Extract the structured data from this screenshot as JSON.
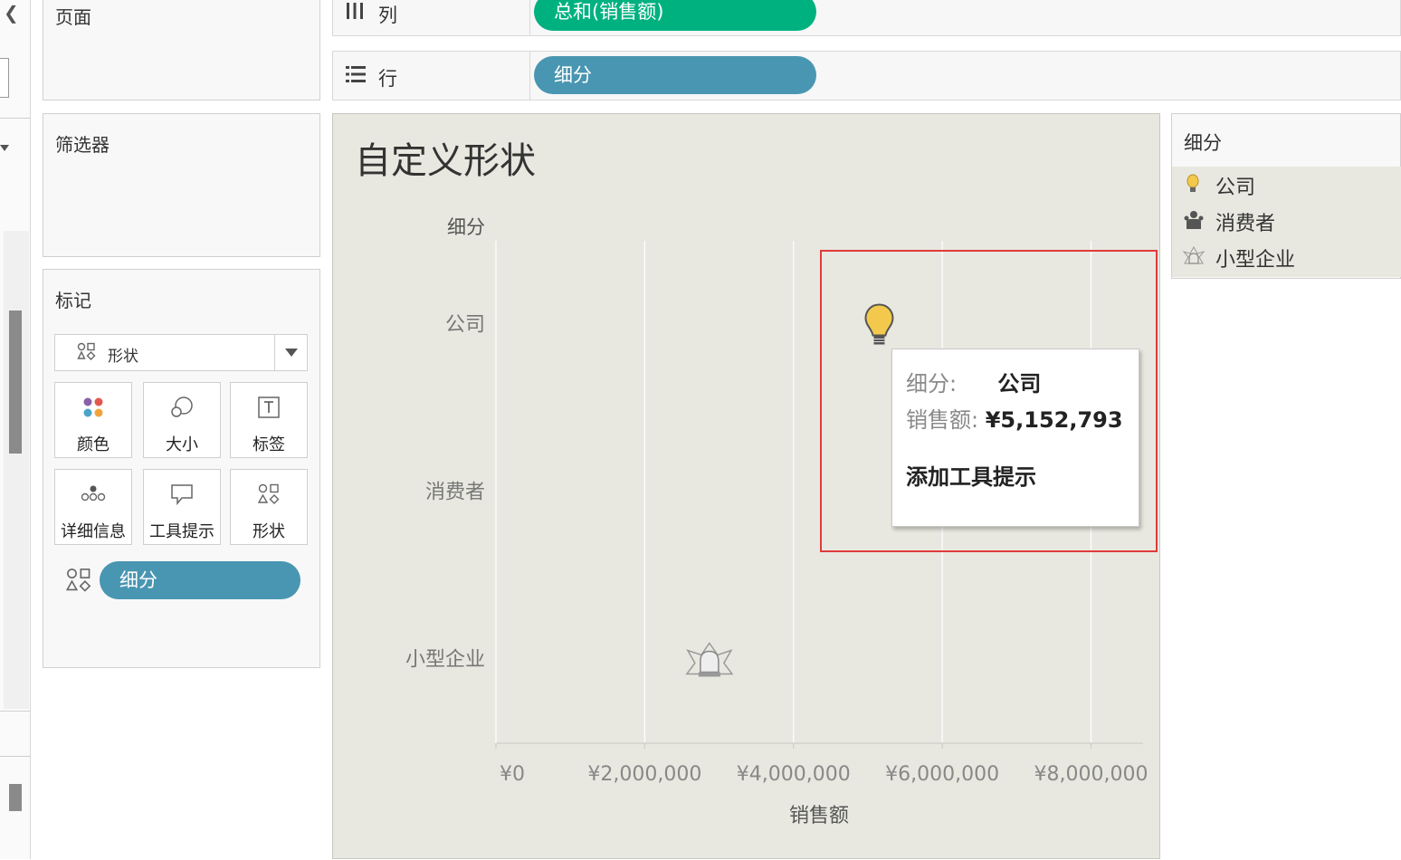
{
  "left_strip": {
    "back_icon": "chevron-left-icon"
  },
  "pages_card": {
    "title": "页面"
  },
  "filters_card": {
    "title": "筛选器"
  },
  "marks_card": {
    "title": "标记",
    "mark_type": "形状",
    "buttons": [
      {
        "label": "颜色",
        "icon": "color-dots-icon"
      },
      {
        "label": "大小",
        "icon": "size-icon"
      },
      {
        "label": "标签",
        "icon": "label-icon"
      },
      {
        "label": "详细信息",
        "icon": "detail-icon"
      },
      {
        "label": "工具提示",
        "icon": "tooltip-icon"
      },
      {
        "label": "形状",
        "icon": "shape-icon"
      }
    ],
    "shape_pill": "细分"
  },
  "shelves": {
    "columns": {
      "label": "列",
      "pill": "总和(销售额)",
      "pill_color": "#00b180"
    },
    "rows": {
      "label": "行",
      "pill": "细分",
      "pill_color": "#4996b2"
    }
  },
  "legend": {
    "title": "细分",
    "items": [
      {
        "label": "公司",
        "icon": "lightbulb-icon"
      },
      {
        "label": "消费者",
        "icon": "people-icon"
      },
      {
        "label": "小型企业",
        "icon": "alarm-light-icon"
      }
    ]
  },
  "tooltip": {
    "segment_key": "细分:",
    "segment_value": "公司",
    "sales_key": "销售额:",
    "sales_value": "¥5,152,793",
    "action": "添加工具提示"
  },
  "chart_data": {
    "type": "scatter",
    "title": "自定义形状",
    "row_header": "细分",
    "xlabel": "销售额",
    "categories": [
      "公司",
      "消费者",
      "小型企业"
    ],
    "x_ticks": [
      "¥0",
      "¥2,000,000",
      "¥4,000,000",
      "¥6,000,000",
      "¥8,000,000"
    ],
    "xlim": [
      0,
      8700000
    ],
    "grid": true,
    "points": [
      {
        "category": "公司",
        "value": 5152793,
        "shape": "lightbulb-icon",
        "color": "#f2c94c"
      },
      {
        "category": "小型企业",
        "value": 2870000,
        "shape": "alarm-light-icon",
        "color": "#9a9a9a"
      }
    ]
  }
}
